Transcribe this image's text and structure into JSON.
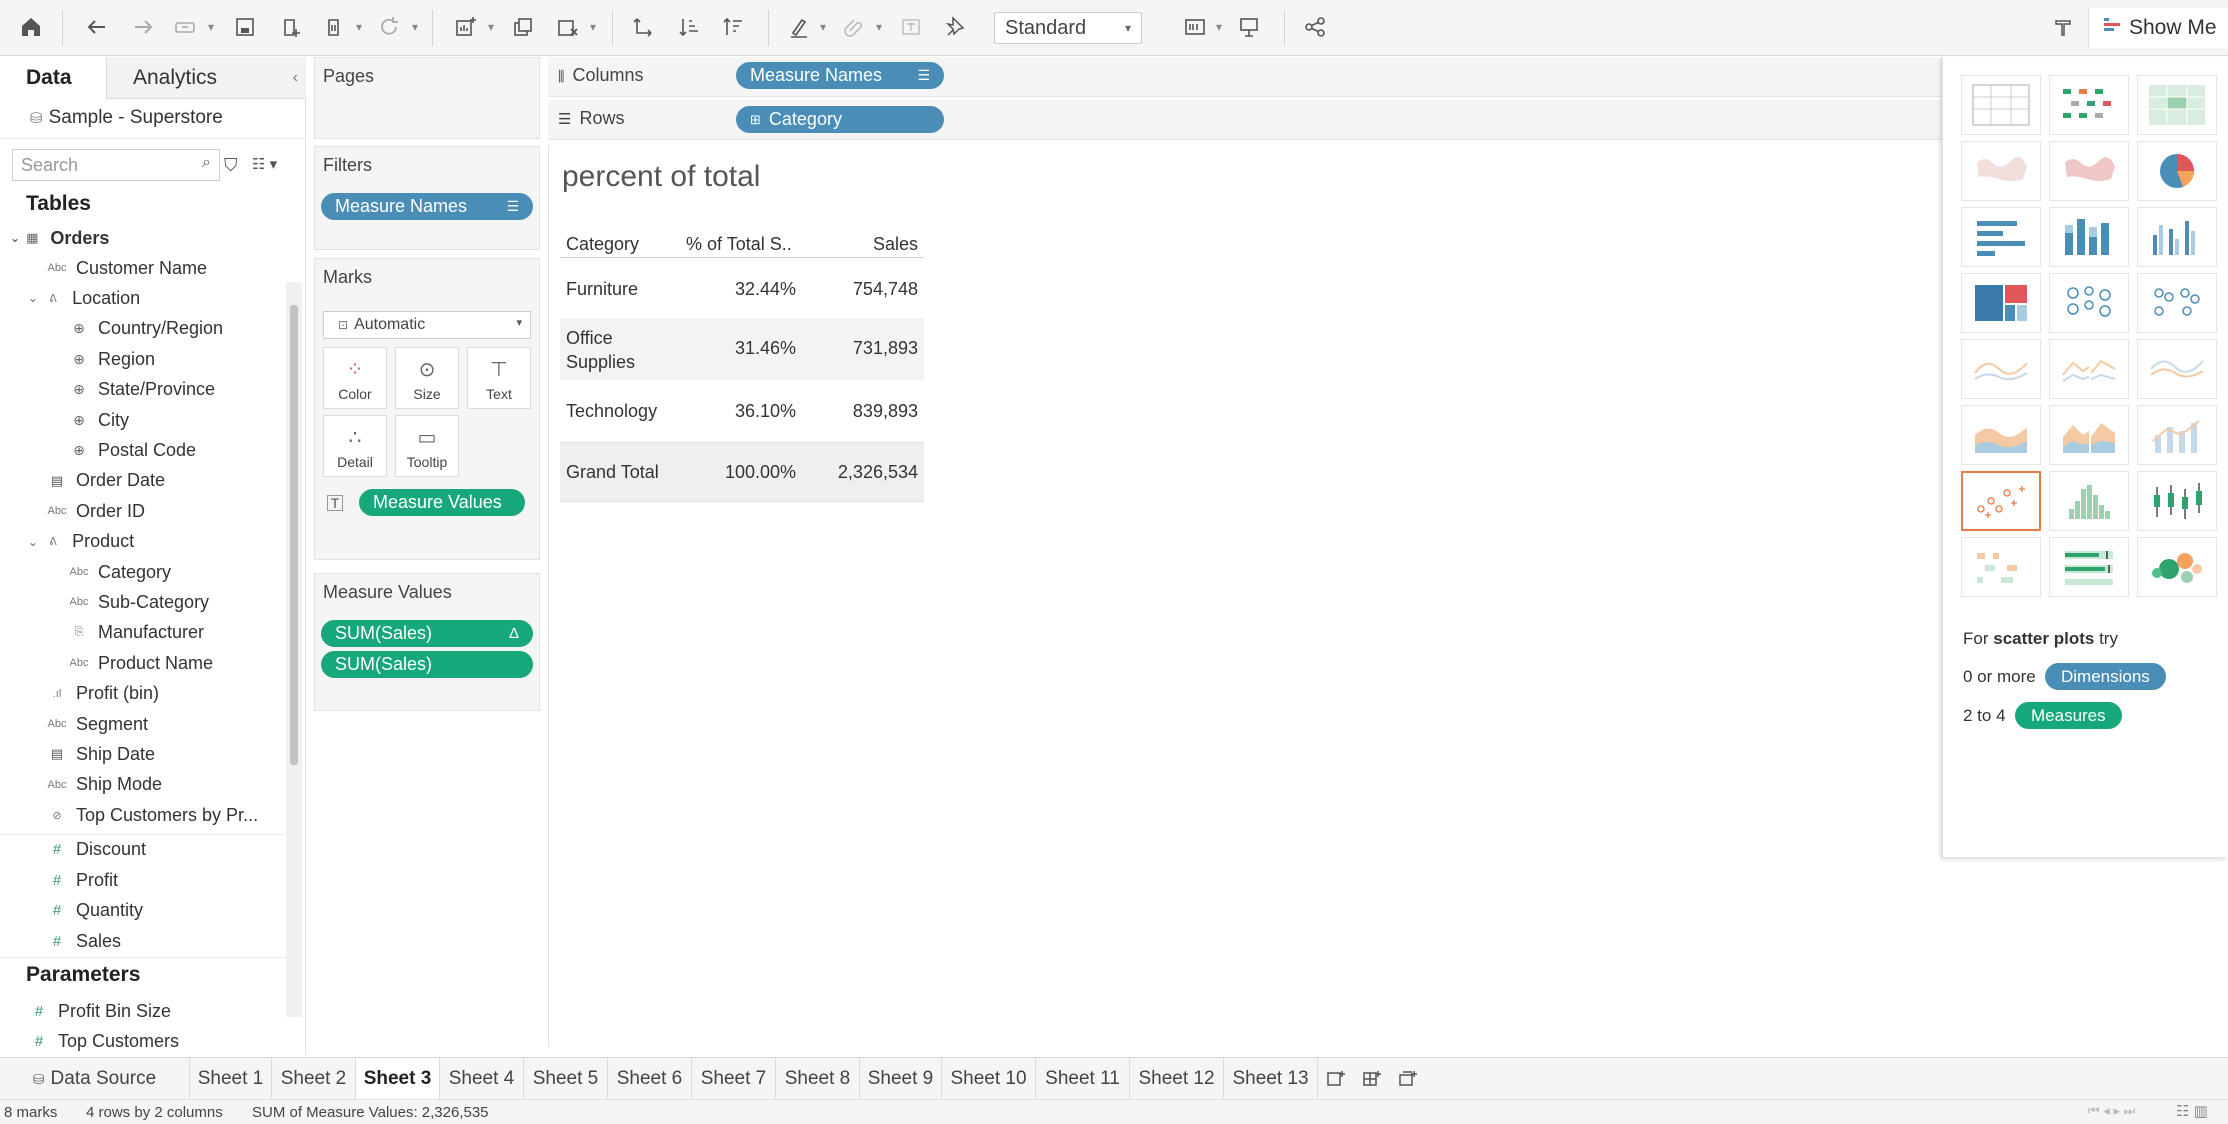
{
  "toolbar": {
    "fit_select": "Standard",
    "show_me_label": "Show Me"
  },
  "data_pane": {
    "tab_data": "Data",
    "tab_analytics": "Analytics",
    "datasource": "Sample - Superstore",
    "search_placeholder": "Search",
    "tables_heading": "Tables",
    "table_name": "Orders",
    "fields": [
      {
        "label": "Customer Name",
        "type": "abc"
      },
      {
        "label": "Location",
        "type": "hier"
      },
      {
        "label": "Country/Region",
        "type": "geo"
      },
      {
        "label": "Region",
        "type": "geo"
      },
      {
        "label": "State/Province",
        "type": "geo"
      },
      {
        "label": "City",
        "type": "geo"
      },
      {
        "label": "Postal Code",
        "type": "geo"
      },
      {
        "label": "Order Date",
        "type": "date"
      },
      {
        "label": "Order ID",
        "type": "abc"
      },
      {
        "label": "Product",
        "type": "hier"
      },
      {
        "label": "Category",
        "type": "abc"
      },
      {
        "label": "Sub-Category",
        "type": "abc"
      },
      {
        "label": "Manufacturer",
        "type": "group"
      },
      {
        "label": "Product Name",
        "type": "abc"
      },
      {
        "label": "Profit (bin)",
        "type": "bin"
      },
      {
        "label": "Segment",
        "type": "abc"
      },
      {
        "label": "Ship Date",
        "type": "date"
      },
      {
        "label": "Ship Mode",
        "type": "abc"
      },
      {
        "label": "Top Customers by Pr...",
        "type": "set"
      },
      {
        "label": "Discount",
        "type": "num"
      },
      {
        "label": "Profit",
        "type": "num"
      },
      {
        "label": "Quantity",
        "type": "num"
      },
      {
        "label": "Sales",
        "type": "num"
      }
    ],
    "parameters_heading": "Parameters",
    "parameters": [
      {
        "label": "Profit Bin Size"
      },
      {
        "label": "Top Customers"
      }
    ]
  },
  "cards": {
    "pages_title": "Pages",
    "filters_title": "Filters",
    "filter_pill": "Measure Names",
    "marks_title": "Marks",
    "mark_type": "Automatic",
    "mark_buttons": [
      "Color",
      "Size",
      "Text",
      "Detail",
      "Tooltip"
    ],
    "marks_pill": "Measure Values",
    "measure_values_title": "Measure Values",
    "measure_pills": [
      "SUM(Sales)",
      "SUM(Sales)"
    ]
  },
  "shelves": {
    "columns_label": "Columns",
    "columns_pill": "Measure Names",
    "rows_label": "Rows",
    "rows_pill": "Category"
  },
  "view": {
    "title": "percent of total",
    "headers": [
      "Category",
      "% of Total S..",
      "Sales"
    ],
    "rows": [
      {
        "category": "Furniture",
        "pct": "32.44%",
        "sales": "754,748"
      },
      {
        "category": "Office Supplies",
        "pct": "31.46%",
        "sales": "731,893"
      },
      {
        "category": "Technology",
        "pct": "36.10%",
        "sales": "839,893"
      }
    ],
    "grand_total": {
      "label": "Grand Total",
      "pct": "100.00%",
      "sales": "2,326,534"
    }
  },
  "show_me": {
    "hint_prefix": "For",
    "hint_bold": "scatter plots",
    "hint_suffix": "try",
    "dims_prefix": "0 or more",
    "dims_pill": "Dimensions",
    "meas_prefix": "2 to 4",
    "meas_pill": "Measures"
  },
  "sheet_tabs": [
    "Data Source",
    "Sheet 1",
    "Sheet 2",
    "Sheet 3",
    "Sheet 4",
    "Sheet 5",
    "Sheet 6",
    "Sheet 7",
    "Sheet 8",
    "Sheet 9",
    "Sheet 10",
    "Sheet 11",
    "Sheet 12",
    "Sheet 13"
  ],
  "active_sheet": "Sheet 3",
  "status": {
    "marks": "8 marks",
    "dims": "4 rows by 2 columns",
    "sum": "SUM of Measure Values: 2,326,535"
  }
}
